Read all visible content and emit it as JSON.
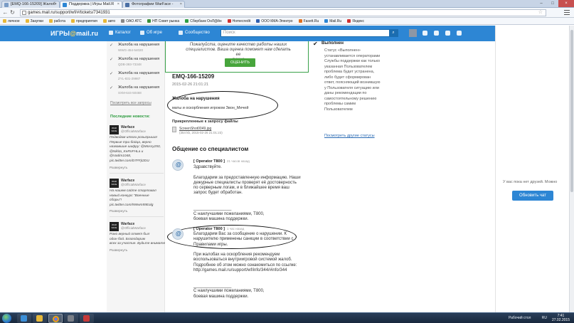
{
  "browser": {
    "tabs": [
      {
        "label": "[EMQ-166-15209] Жалоб",
        "color": "#7a9cc6"
      },
      {
        "label": "Поддержка | Игры Mail.R",
        "color": "#2d86d4"
      },
      {
        "label": "Фотографии WarFace -",
        "color": "#4a6fa5"
      }
    ],
    "url": "games.mail.ru/support/wf/#/tickets/7341931",
    "bookmarks": [
      {
        "label": "личное",
        "color": "#e6b83a"
      },
      {
        "label": "Закупки",
        "color": "#e6b83a"
      },
      {
        "label": "работа",
        "color": "#e6b83a"
      },
      {
        "label": "предприятия",
        "color": "#e6b83a"
      },
      {
        "label": "авто",
        "color": "#e6b83a"
      },
      {
        "label": "ОАО АТС",
        "color": "#888888"
      },
      {
        "label": "НП Совет рынка",
        "color": "#3a8f3a"
      },
      {
        "label": "Сбербанк ОнЛ@йн",
        "color": "#2f9e44"
      },
      {
        "label": "Homecredit",
        "color": "#d03030"
      },
      {
        "label": "ООО КМА-Электро",
        "color": "#3060b0"
      },
      {
        "label": "Fasett.Ru",
        "color": "#e07020"
      },
      {
        "label": "Mail.Ru",
        "color": "#2d86d4"
      },
      {
        "label": "Яндекс",
        "color": "#d03030"
      }
    ]
  },
  "site": {
    "logo_main": "ИГРЫ",
    "logo_at": "@",
    "logo_rest": "mail.ru",
    "nav": [
      "Каталог",
      "Об игре",
      "Сообщество"
    ],
    "search_placeholder": "Поиск"
  },
  "sidebar": {
    "complaints": [
      {
        "title": "Жалоба на нарушения",
        "id": "WWG-454-54020"
      },
      {
        "title": "Жалоба на нарушения",
        "id": "QDB-393-73348"
      },
      {
        "title": "Жалоба на нарушения",
        "id": "ZYL-831-29987"
      },
      {
        "title": "Жалоба на нарушения",
        "id": "SXM-644-50468"
      }
    ],
    "see_all": "Посмотреть все запросы",
    "news_header": "Последние новости:",
    "tweets": [
      {
        "name": "Warface",
        "handle": "@OfficialWarface",
        "lines": [
          "Подводим итоги розыгрыша!",
          "Первые три бойца, верно",
          "назвавшие шифру: @Mossy250,",
          "@Nikita_KeRnFHLa и",
          "@Vadim1048,",
          "pic.twitter.com/D7FFjt2DU"
        ],
        "more": "Развернуть"
      },
      {
        "name": "Warface",
        "handle": "@OfficialWarface",
        "lines": [
          "На нашем сайте стартовал",
          "новый конкурс \"Военные",
          "сборы\"!",
          "pic.twitter.com/9Wwm59Ealg"
        ],
        "more": "Развернуть"
      },
      {
        "name": "Warface",
        "handle": "@OfficialWarface",
        "lines": [
          "Рано верный ответ был",
          "один бой. Благодарим",
          "всех за участие. Будьте внимательны!"
        ],
        "more": "Развернуть"
      }
    ]
  },
  "ticket": {
    "rate_lines": [
      "Пожалуйста, оцените качество работы наших",
      "специалистов. Ваша оценка поможет нам сделать ее",
      "лучше"
    ],
    "rate_button": "ОЦЕНИТЬ",
    "id": "EMQ-166-15209",
    "date": "2015-02-26 21:01:21",
    "complaint_title": "Жалоба на нарушения",
    "complaint_text": "маты и оскорбления игроком Звон_Мечей",
    "attachments_title": "Прикрепленные к запросу файлы",
    "attachment_name": "ScreenShot0049.jpg",
    "attachment_meta": "(354 kb, 2015-02-26 21:01:23)",
    "conversation_title": "Общение со специалистом"
  },
  "messages": [
    {
      "author": "[ Operator T800 ]",
      "time": "21 часов назад",
      "lines": [
        "Здравствуйте.",
        "",
        "Благодарим за предоставленную информацию. Наши",
        "дежурные специалисты проверят её достоверность",
        "по серверным логам, и в ближайшее время ваш",
        "запрос будет обработан.",
        "",
        "",
        "________________",
        "С наилучшими пожеланиями, T800,",
        "боевая машина поддержки."
      ]
    },
    {
      "author": "[ Operator T800 ]",
      "time": "1 час назад",
      "lines": [
        "Благодарим Вас за сообщение о нарушении. К",
        "нарушителю применены санкции в соответствии с",
        "Правилами игры.",
        "",
        "При жалобах на оскорбления рекомендуем",
        "воспользоваться внутриигровой системой жалоб.",
        "Подробнее об этом можно ознакомиться по ссылке:",
        "http://games.mail.ru/support/wf/info/344/#info/344",
        "",
        "",
        "________________",
        "С наилучшими пожеланиями, T800,",
        "боевая машина поддержки."
      ]
    }
  ],
  "status": {
    "label": "Выполнен",
    "desc": [
      "Статус «Выполнен»",
      "устанавливается операторами",
      "Службы поддержки как только",
      "указанная Пользователем",
      "проблема будет устранена,",
      "либо будет сформирован",
      "ответ, поясняющий возникшую",
      "у Пользователя ситуацию или",
      "даны рекомендации по",
      "самостоятельному решению",
      "проблемы самим",
      "Пользователем"
    ],
    "other_link": "Посмотреть другие статусы"
  },
  "chat": {
    "no_friends": "У вас пока нет друзей. Можно",
    "button": "Обновить чат"
  },
  "taskbar": {
    "tray_label": "Рабочий стол",
    "lang": "RU",
    "time": "7:41",
    "date": "27.02.2015"
  }
}
